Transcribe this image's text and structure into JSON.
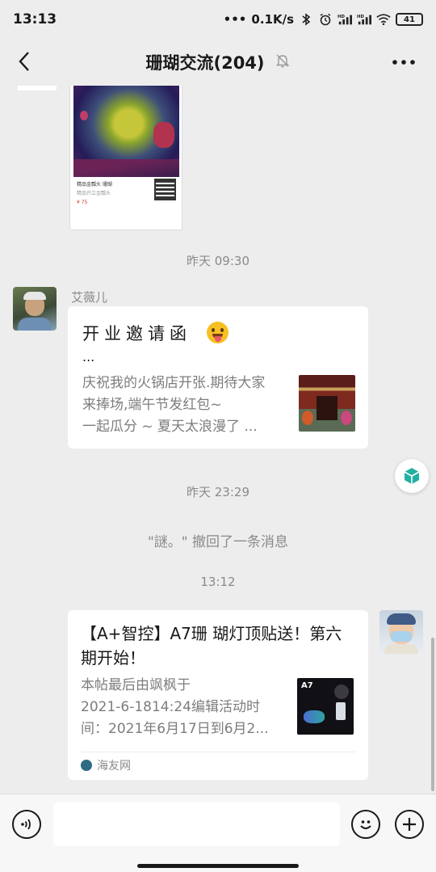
{
  "status_bar": {
    "time": "13:13",
    "network_speed": "0.1K/s",
    "battery": "41",
    "icons": [
      "dots-icon",
      "bluetooth-icon",
      "alarm-icon",
      "signal-hd-icon",
      "signal-hd-icon",
      "wifi-icon",
      "battery-icon"
    ]
  },
  "header": {
    "title": "珊瑚交流(204)",
    "back_icon": "chevron-left-icon",
    "mute_icon": "bell-muted-icon",
    "more_icon": "more-dots-icon"
  },
  "messages": {
    "image_card": {
      "caption_title": "精品金瓢头 珊瑚",
      "caption_sub": "精品开立金瓢头",
      "price": "¥ 75"
    },
    "timestamp_1": "昨天 09:30",
    "sender_1": "艾薇儿",
    "card_1": {
      "title": "开业邀请函",
      "ellipsis": "...",
      "description": "庆祝我的火锅店开张.期待大家\n来捧场,端午节发红包~\n一起瓜分 ~   夏天太浪漫了 ..."
    },
    "timestamp_2": "昨天 23:29",
    "recall_notice": "\"謎。\" 撤回了一条消息",
    "timestamp_3": "13:12",
    "card_2": {
      "title": "【A+智控】A7珊 瑚灯顶贴送！第六期开始！",
      "description": "本帖最后由飒枫于\n2021-6-1814:24编辑活动时\n间：2021年6月17日到6月2...",
      "thumb_label": "A7",
      "source": "海友网"
    }
  },
  "input_bar": {
    "voice_icon": "voice-icon",
    "emoji_icon": "emoji-icon",
    "plus_icon": "plus-icon",
    "text_value": ""
  },
  "colors": {
    "background": "#ededed",
    "card": "#ffffff",
    "muted_text": "#8a8a8a"
  }
}
